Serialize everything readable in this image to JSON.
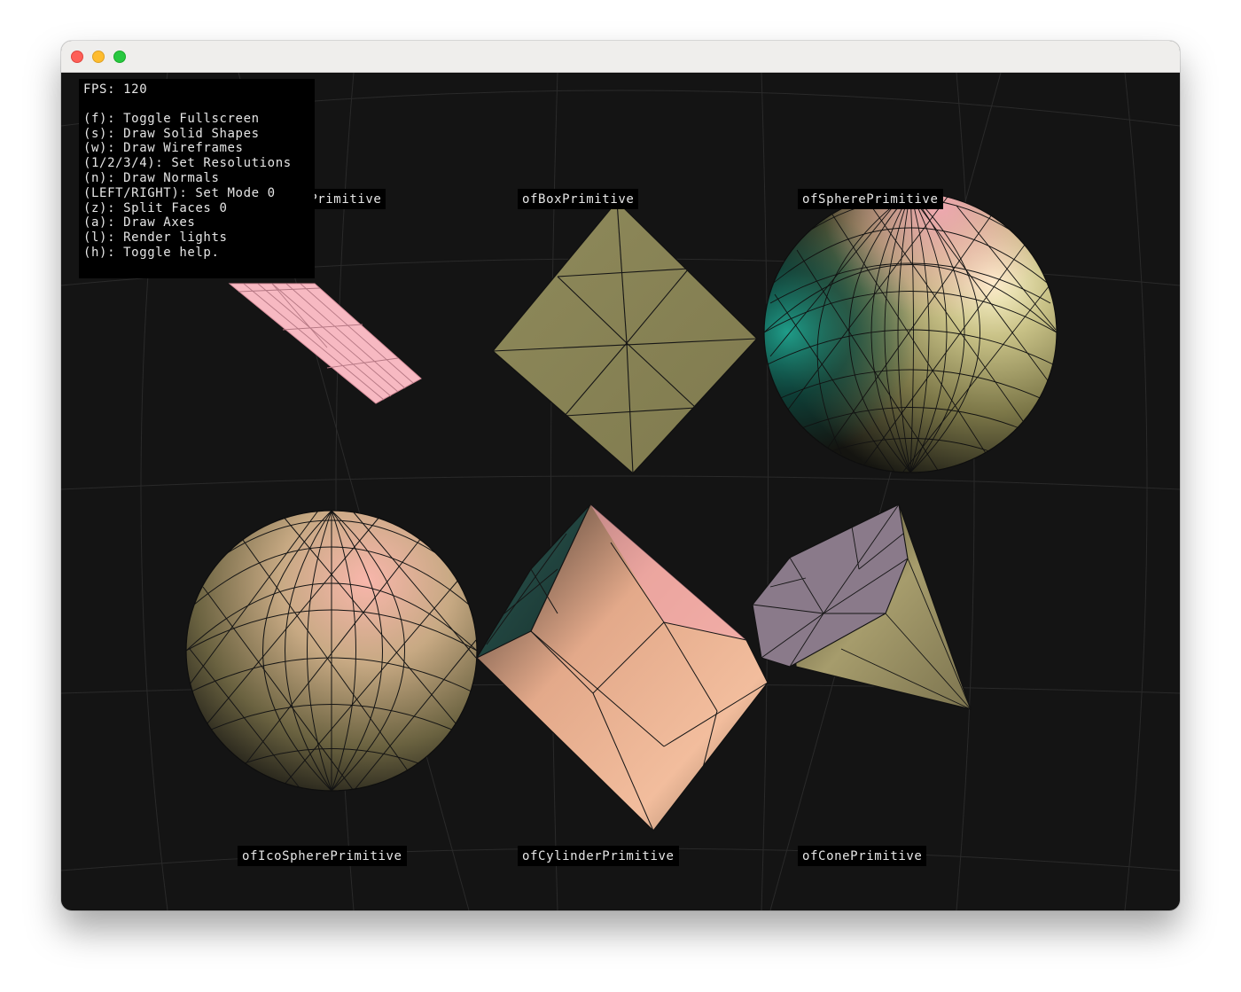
{
  "window": {
    "controls": [
      "close",
      "minimize",
      "maximize"
    ]
  },
  "hud": {
    "fps": "FPS: 120",
    "help_lines": [
      "(f): Toggle Fullscreen",
      "(s): Draw Solid Shapes",
      "(w): Draw Wireframes",
      "(1/2/3/4): Set Resolutions",
      "(n): Draw Normals",
      "(LEFT/RIGHT): Set Mode 0",
      "(z): Split Faces 0",
      "(a): Draw Axes",
      "(l): Render lights",
      "(h): Toggle help."
    ]
  },
  "labels": {
    "plane": "ofPlanePrimitive",
    "box": "ofBoxPrimitive",
    "sphere": "ofSpherePrimitive",
    "icosphere": "ofIcoSpherePrimitive",
    "cylinder": "ofCylinderPrimitive",
    "cone": "ofConePrimitive"
  },
  "colors": {
    "background": "#141414",
    "plane": "#f7b9c2",
    "box": "#8a8556",
    "sphere_base": "#9e9866",
    "sphere_teal": "#0d5a52",
    "icosphere_pink": "#f3aba7",
    "cylinder_peach": "#f0b594",
    "cone_lilac": "#8a7a8a",
    "cone_olive": "#9d9468"
  }
}
